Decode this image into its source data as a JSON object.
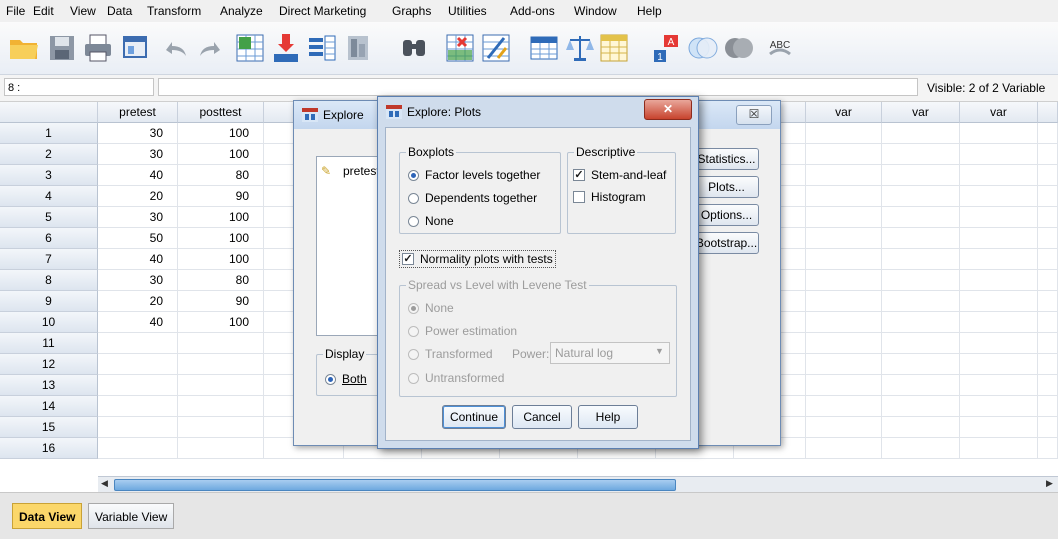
{
  "menubar": {
    "items": [
      "File",
      "Edit",
      "View",
      "Data",
      "Transform",
      "Analyze",
      "Direct Marketing",
      "Graphs",
      "Utilities",
      "Add-ons",
      "Window",
      "Help"
    ]
  },
  "toolbar": {
    "icons": [
      "open-folder-icon",
      "save-icon",
      "print-icon",
      "dialog-recall-icon",
      "undo-icon",
      "redo-icon",
      "goto-case-icon",
      "goto-variable-icon",
      "variables-icon",
      "run-descriptives-icon",
      "find-icon",
      "insert-cases-icon",
      "insert-variable-icon",
      "split-file-icon",
      "weight-cases-icon",
      "select-cases-icon",
      "value-labels-icon",
      "use-sets-icon",
      "show-all-variables-icon",
      "spell-check-icon"
    ]
  },
  "cellbar": {
    "cell_name": "8 :",
    "visible": "Visible: 2 of 2 Variable"
  },
  "grid": {
    "columns": [
      "pretest",
      "posttest",
      "var",
      "var",
      "var"
    ],
    "rows": [
      {
        "num": "1",
        "pretest": "30",
        "posttest": "100"
      },
      {
        "num": "2",
        "pretest": "30",
        "posttest": "100"
      },
      {
        "num": "3",
        "pretest": "40",
        "posttest": "80"
      },
      {
        "num": "4",
        "pretest": "20",
        "posttest": "90"
      },
      {
        "num": "5",
        "pretest": "30",
        "posttest": "100"
      },
      {
        "num": "6",
        "pretest": "50",
        "posttest": "100"
      },
      {
        "num": "7",
        "pretest": "40",
        "posttest": "100"
      },
      {
        "num": "8",
        "pretest": "30",
        "posttest": "80"
      },
      {
        "num": "9",
        "pretest": "20",
        "posttest": "90"
      },
      {
        "num": "10",
        "pretest": "40",
        "posttest": "100"
      },
      {
        "num": "11",
        "pretest": "",
        "posttest": ""
      },
      {
        "num": "12",
        "pretest": "",
        "posttest": ""
      },
      {
        "num": "13",
        "pretest": "",
        "posttest": ""
      },
      {
        "num": "14",
        "pretest": "",
        "posttest": ""
      },
      {
        "num": "15",
        "pretest": "",
        "posttest": ""
      },
      {
        "num": "16",
        "pretest": "",
        "posttest": ""
      }
    ]
  },
  "tabs": {
    "data_view": "Data View",
    "variable_view": "Variable View"
  },
  "explore": {
    "title": "Explore",
    "list_item": "pretest",
    "buttons": [
      "Statistics...",
      "Plots...",
      "Options...",
      "Bootstrap..."
    ],
    "display_label": "Display",
    "display_both": "Both"
  },
  "plots": {
    "title": "Explore: Plots",
    "boxplots_label": "Boxplots",
    "boxplots_options": [
      "Factor levels together",
      "Dependents together",
      "None"
    ],
    "descriptive_label": "Descriptive",
    "stem_and_leaf": "Stem-and-leaf",
    "histogram": "Histogram",
    "normality": "Normality plots with tests",
    "spread_label": "Spread vs Level with Levene Test",
    "spread_options": [
      "None",
      "Power estimation",
      "Transformed",
      "Untransformed"
    ],
    "power_label": "Power:",
    "power_value": "Natural log",
    "continue": "Continue",
    "cancel": "Cancel",
    "help": "Help"
  },
  "colors": {
    "selection_blue": "#3f6fb5",
    "tab_active": "#fbd76a"
  }
}
